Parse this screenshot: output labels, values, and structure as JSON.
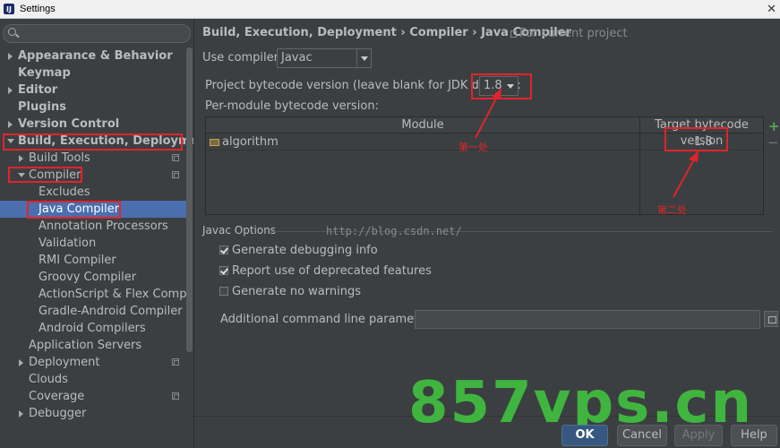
{
  "window": {
    "title": "Settings",
    "app_icon": "IJ"
  },
  "search": {
    "placeholder": ""
  },
  "sidebar": {
    "items": [
      {
        "label": "Appearance & Behavior"
      },
      {
        "label": "Keymap"
      },
      {
        "label": "Editor"
      },
      {
        "label": "Plugins"
      },
      {
        "label": "Version Control"
      },
      {
        "label": "Build, Execution, Deployment"
      },
      {
        "label": "Build Tools"
      },
      {
        "label": "Compiler"
      },
      {
        "label": "Excludes"
      },
      {
        "label": "Java Compiler"
      },
      {
        "label": "Annotation Processors"
      },
      {
        "label": "Validation"
      },
      {
        "label": "RMI Compiler"
      },
      {
        "label": "Groovy Compiler"
      },
      {
        "label": "ActionScript & Flex Compi..."
      },
      {
        "label": "Gradle-Android Compiler"
      },
      {
        "label": "Android Compilers"
      },
      {
        "label": "Application Servers"
      },
      {
        "label": "Deployment"
      },
      {
        "label": "Clouds"
      },
      {
        "label": "Coverage"
      },
      {
        "label": "Debugger"
      }
    ]
  },
  "header": {
    "breadcrumb": "Build, Execution, Deployment › Compiler › Java Compiler",
    "scope_note": "For current project"
  },
  "compiler": {
    "use_label": "Use compiler:",
    "use_value": "Javac",
    "bytecode_label": "Project bytecode version (leave blank for JDK default):",
    "bytecode_value": "1.8",
    "per_module_label": "Per-module bytecode version:"
  },
  "module_table": {
    "columns": [
      "Module",
      "Target bytecode version"
    ],
    "rows": [
      {
        "module": "algorithm",
        "version": "1.8"
      }
    ]
  },
  "annotations": {
    "first": "第一处",
    "second": "第二处"
  },
  "javac": {
    "section_title": "Javac Options",
    "watermark": "http://blog.csdn.net/",
    "options": [
      {
        "label": "Generate debugging info",
        "checked": true
      },
      {
        "label": "Report use of deprecated features",
        "checked": true
      },
      {
        "label": "Generate no warnings",
        "checked": false
      }
    ],
    "params_label": "Additional command line parameters:",
    "params_value": ""
  },
  "buttons": {
    "ok": "OK",
    "cancel": "Cancel",
    "apply": "Apply",
    "help": "Help"
  },
  "brand_watermark": "857vps.cn",
  "colors": {
    "selection": "#4b6eaf",
    "highlight": "#e0242a",
    "brand": "#3fb53f"
  }
}
